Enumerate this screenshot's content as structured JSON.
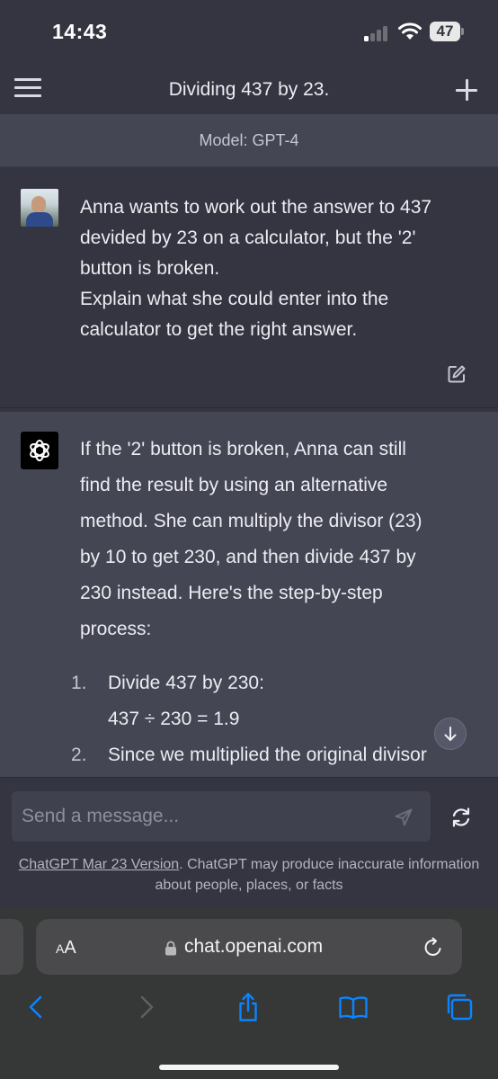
{
  "status_bar": {
    "time": "14:43",
    "battery": "47"
  },
  "header": {
    "title": "Dividing 437 by 23.",
    "menu_icon": "hamburger-menu-icon",
    "new_chat_icon": "plus-icon"
  },
  "model_bar": {
    "label": "Model: GPT-4"
  },
  "conversation": {
    "user_message": {
      "lines": [
        "Anna wants to work out the answer to 437",
        "devided by 23 on a calculator, but the '2'",
        "button is broken.",
        "Explain what she could enter into the",
        "calculator to get the right answer."
      ]
    },
    "assistant_message": {
      "lines": [
        "If the '2' button is broken, Anna can still",
        "find the result by using an alternative",
        "method. She can multiply the divisor (23)",
        "by 10 to get 230, and then divide 437 by",
        "230 instead. Here's the step-by-step",
        "process:"
      ],
      "steps": [
        {
          "number": "1.",
          "lines": [
            "Divide 437 by 230:",
            "437 ÷ 230 = 1.9"
          ]
        },
        {
          "number": "2.",
          "lines": [
            "Since we multiplied the original divisor"
          ]
        }
      ]
    }
  },
  "composer": {
    "placeholder": "Send a message...",
    "disclaimer_link": "ChatGPT Mar 23 Version",
    "disclaimer_text": ". ChatGPT may produce inaccurate information about people, places, or facts"
  },
  "browser": {
    "aa_label_large": "A",
    "aa_label_small": "A",
    "url": "chat.openai.com"
  },
  "colors": {
    "background": "#343541",
    "assistant_background": "#444654",
    "text": "#ececf1",
    "browser_chrome": "#363737",
    "browser_accent": "#0a84ff"
  }
}
